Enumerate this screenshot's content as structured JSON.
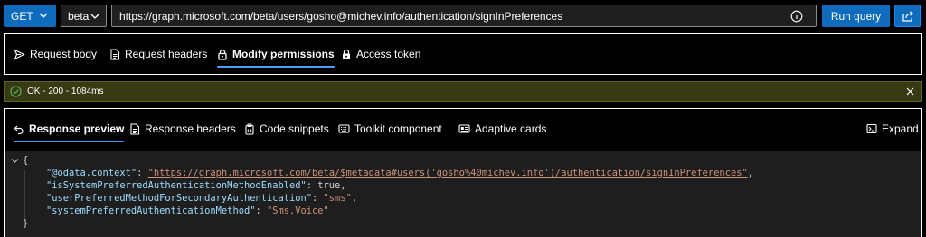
{
  "query": {
    "method": "GET",
    "version": "beta",
    "url": "https://graph.microsoft.com/beta/users/gosho@michev.info/authentication/signInPreferences",
    "run_label": "Run query"
  },
  "request_tabs": [
    {
      "label": "Request body",
      "icon": "send-icon"
    },
    {
      "label": "Request headers",
      "icon": "document-icon"
    },
    {
      "label": "Modify permissions",
      "icon": "lock-icon",
      "active": true
    },
    {
      "label": "Access token",
      "icon": "lock-icon"
    }
  ],
  "status": {
    "text": "OK - 200 - 1084ms"
  },
  "response_tabs": [
    {
      "label": "Response preview",
      "icon": "undo-arrow-icon",
      "active": true
    },
    {
      "label": "Response headers",
      "icon": "document-icon"
    },
    {
      "label": "Code snippets",
      "icon": "clipboard-icon"
    },
    {
      "label": "Toolkit component",
      "icon": "keyboard-icon"
    },
    {
      "label": "Adaptive cards",
      "icon": "card-icon"
    }
  ],
  "expand_label": "Expand",
  "response": {
    "open_brace": "{",
    "close_brace": "}",
    "lines": [
      {
        "key": "\"@odata.context\"",
        "value": "\"https://graph.microsoft.com/beta/$metadata#users('gosho%40michev.info')/authentication/signInPreferences\"",
        "trail": ",",
        "type": "string-link"
      },
      {
        "key": "\"isSystemPreferredAuthenticationMethodEnabled\"",
        "value": "true",
        "trail": ",",
        "type": "literal"
      },
      {
        "key": "\"userPreferredMethodForSecondaryAuthentication\"",
        "value": "\"sms\"",
        "trail": ",",
        "type": "string"
      },
      {
        "key": "\"systemPreferredAuthenticationMethod\"",
        "value": "\"Sms,Voice\"",
        "trail": "",
        "type": "string"
      }
    ]
  },
  "colors": {
    "accent": "#0f6cbd",
    "tab_underline": "#479ef5",
    "status_bg": "#383a13",
    "json_key": "#9cdcfe",
    "json_string": "#ce9178"
  }
}
